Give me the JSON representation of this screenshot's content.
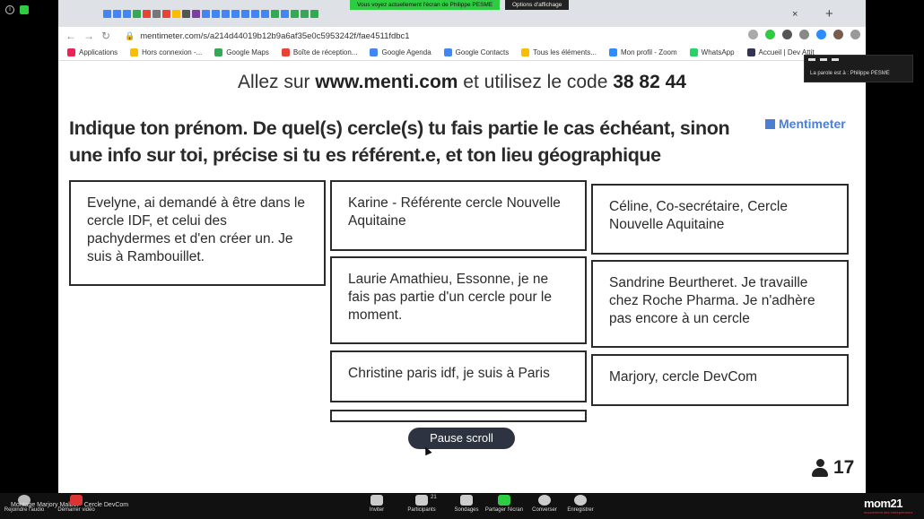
{
  "browser": {
    "share_banner": "Vous voyez actuellement l'écran de Philippe PESME",
    "view_options": "Options d'affichage",
    "tab_close": "×",
    "new_tab": "+",
    "url": "mentimeter.com/s/a214d44019b12b9a6af35e0c5953242f/fae4511fdbc1"
  },
  "bookmarks": [
    {
      "label": "Applications",
      "color": "#e25"
    },
    {
      "label": "Hors connexion -...",
      "color": "#fbbc04"
    },
    {
      "label": "Google Maps",
      "color": "#34a853"
    },
    {
      "label": "Boîte de réception...",
      "color": "#ea4335"
    },
    {
      "label": "Google Agenda",
      "color": "#4285f4"
    },
    {
      "label": "Google Contacts",
      "color": "#4285f4"
    },
    {
      "label": "Tous les éléments...",
      "color": "#fbbc04"
    },
    {
      "label": "Mon profil - Zoom",
      "color": "#2d8cff"
    },
    {
      "label": "WhatsApp",
      "color": "#25d366"
    },
    {
      "label": "Accueil | Dev Attit",
      "color": "#335"
    }
  ],
  "menti": {
    "join_prefix": "Allez sur ",
    "join_url": "www.menti.com",
    "join_mid": " et utilisez le code ",
    "join_code": "38 82 44",
    "logo": "Mentimeter",
    "question": "Indique ton prénom. De quel(s) cercle(s) tu fais partie le cas échéant, sinon une info sur toi, précise si tu es référent.e, et ton lieu géographique",
    "cards": [
      {
        "text": "Evelyne, ai demandé à être dans le cercle IDF, et celui des pachydermes et d'en créer un. Je suis à Rambouillet.",
        "color": "yellow"
      },
      {
        "text": "Karine - Référente cercle Nouvelle Aquitaine",
        "color": "yellow"
      },
      {
        "text": "Céline, Co-secrétaire, Cercle Nouvelle Aquitaine",
        "color": "yellow"
      },
      {
        "text": "Laurie Amathieu, Essonne, je ne fais pas partie d'un cercle pour le moment.",
        "color": "purple"
      },
      {
        "text": "Sandrine Beurtheret. Je travaille chez Roche Pharma. Je n'adhère pas encore à un cercle",
        "color": "purple"
      },
      {
        "text": "Christine paris idf, je suis à Paris",
        "color": "blue"
      },
      {
        "text": "Marjory, cercle DevCom",
        "color": "blue"
      },
      {
        "text": "",
        "color": "pink"
      }
    ],
    "pause_label": "Pause scroll",
    "participants": "17"
  },
  "speaker": {
    "text": "La parole est à : Philippe PESME"
  },
  "zoom": {
    "name_label": "Montage Marjory Malbot - Cercle DevCom",
    "audio_label": "Rejoindre l'audio",
    "video_label": "Démarrer vidéo",
    "participants_count": "21",
    "buttons": [
      "Inviter",
      "Participants",
      "Sondages",
      "Partager l'écran",
      "Converser",
      "Enregistrer"
    ],
    "brand": "mom21",
    "brand_sub": "mouvement des entrepreneurs"
  }
}
